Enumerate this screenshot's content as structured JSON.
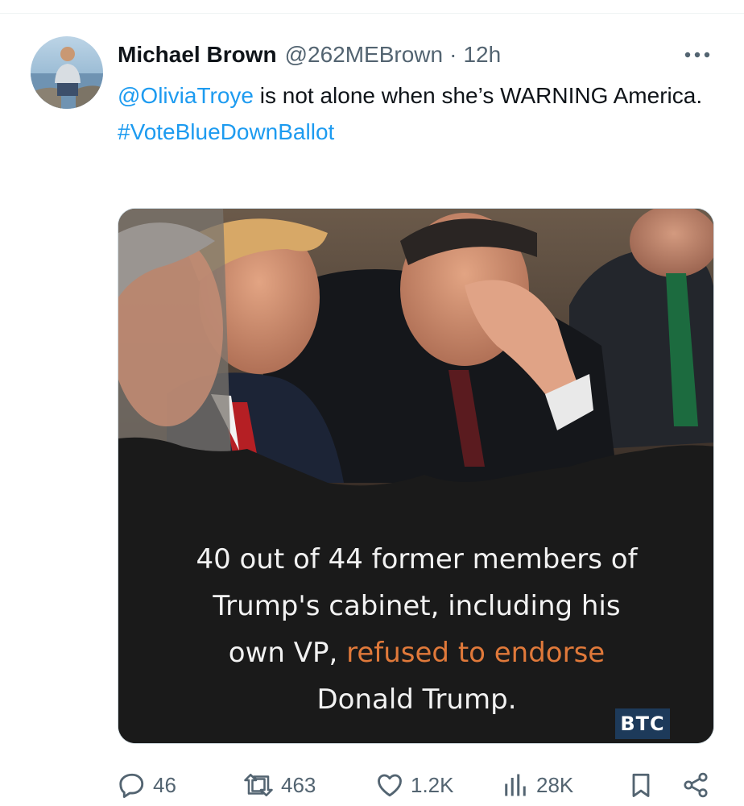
{
  "tweet": {
    "author_name": "Michael Brown",
    "handle": "@262MEBrown",
    "separator": "·",
    "time": "12h",
    "text": {
      "mention": "@OliviaTroye",
      "body": " is not alone when she’s WARNING America.",
      "hashtag": "#VoteBlueDownBallot"
    },
    "more_icon": "more-horizontal-icon"
  },
  "media": {
    "caption_line1": "40 out of 44 former members of",
    "caption_line2": "Trump's cabinet, including his",
    "caption_line3_a": "own VP, ",
    "caption_line3_highlight": "refused to endorse",
    "caption_line4": "Donald Trump.",
    "watermark": "BTC",
    "highlight_color": "#e0793a"
  },
  "actions": {
    "replies": {
      "icon": "reply-icon",
      "count": "46"
    },
    "retweets": {
      "icon": "retweet-icon",
      "count": "463"
    },
    "likes": {
      "icon": "like-icon",
      "count": "1.2K"
    },
    "views": {
      "icon": "views-icon",
      "count": "28K"
    },
    "bookmark": {
      "icon": "bookmark-icon"
    },
    "share": {
      "icon": "share-icon"
    }
  },
  "colors": {
    "link": "#1d9bf0",
    "secondary_text": "#536471",
    "primary_text": "#0f1419"
  }
}
